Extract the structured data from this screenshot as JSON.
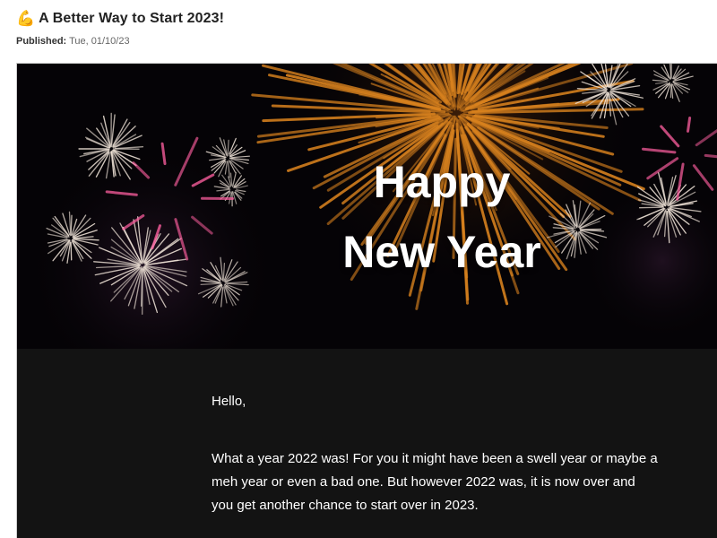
{
  "header": {
    "emoji_icon": "flexed-biceps-icon",
    "emoji_glyph": "💪",
    "title": "A Better Way to Start 2023!",
    "published_label": "Published:",
    "published_date": "Tue, 01/10/23"
  },
  "hero": {
    "line1": "Happy",
    "line2": "New Year"
  },
  "body": {
    "greeting": "Hello,",
    "paragraph": "What a year 2022 was! For you it might have been a swell year or maybe a meh year or even a bad one. But however 2022 was, it is now over and you get another chance to start over in 2023."
  },
  "colors": {
    "background": "#ffffff",
    "hero_background": "#050306",
    "body_background": "#131313",
    "firework_gold": "#d9821e",
    "firework_white": "#f2e6da",
    "firework_pink": "#ff5fa0"
  }
}
